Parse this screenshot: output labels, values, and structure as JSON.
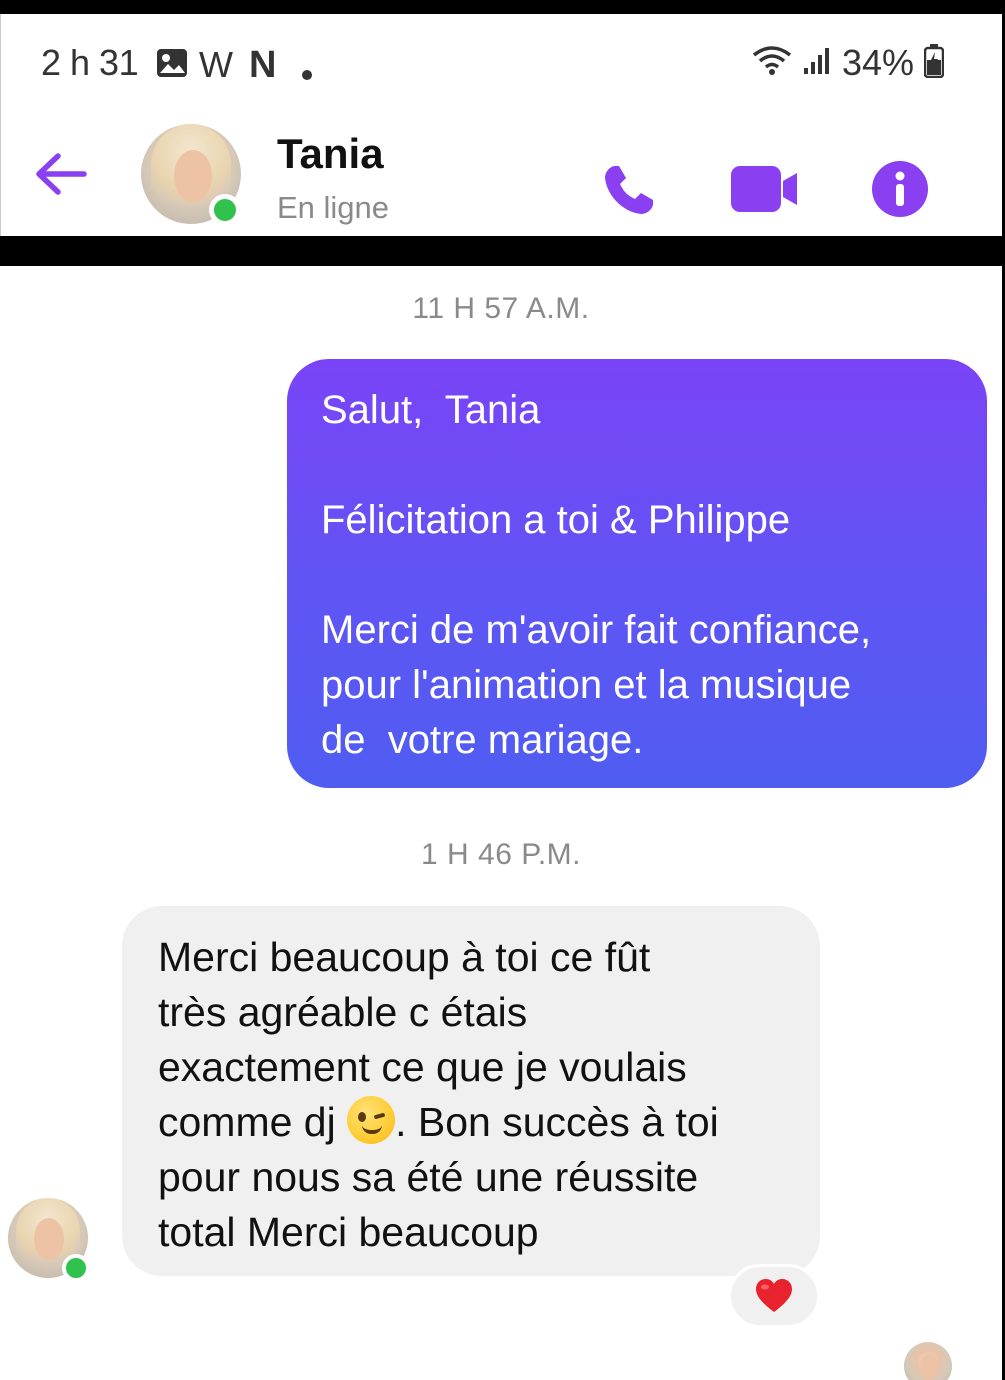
{
  "status_bar": {
    "time": "2 h 31",
    "notification_icons": [
      "image-icon",
      "w-icon",
      "netflix-icon",
      "dot-icon"
    ],
    "notification_glyphs": {
      "w": "W",
      "netflix": "N"
    },
    "battery_percent": "34%",
    "icons": [
      "wifi-icon",
      "signal-icon",
      "battery-charging-icon"
    ]
  },
  "header": {
    "contact_name": "Tania",
    "contact_status": "En ligne",
    "online": true,
    "actions": [
      "back-arrow-icon",
      "phone-icon",
      "video-camera-icon",
      "info-icon"
    ]
  },
  "conversation": {
    "timestamp_1": "11 H 57 A.M.",
    "outgoing_message": {
      "line_1": "Salut,  Tania",
      "line_2": "Félicitation a toi & Philippe",
      "line_3": "Merci de m'avoir fait confiance,",
      "line_4": "pour l'animation et la musique",
      "line_5": "de  votre mariage."
    },
    "timestamp_2": "1 H 46 P.M.",
    "incoming_message": {
      "line_1": "Merci beaucoup à toi ce fût",
      "line_2": "très agréable c étais",
      "line_3": "exactement ce que je voulais",
      "line_4_before_emoji": "comme dj ",
      "emoji": "winking-face",
      "line_4_after_emoji": ". Bon succès à toi",
      "line_5": "pour nous sa été une réussite",
      "line_6": "total Merci beaucoup"
    },
    "reaction": "heart",
    "seen_by": "Tania"
  },
  "colors": {
    "accent": "#8a3ff0",
    "outgoing_bubble_top": "#7a44f6",
    "outgoing_bubble_bottom": "#4f5df1",
    "incoming_bubble": "#f0f0f0",
    "online": "#31c24d",
    "heart": "#e8232d"
  }
}
